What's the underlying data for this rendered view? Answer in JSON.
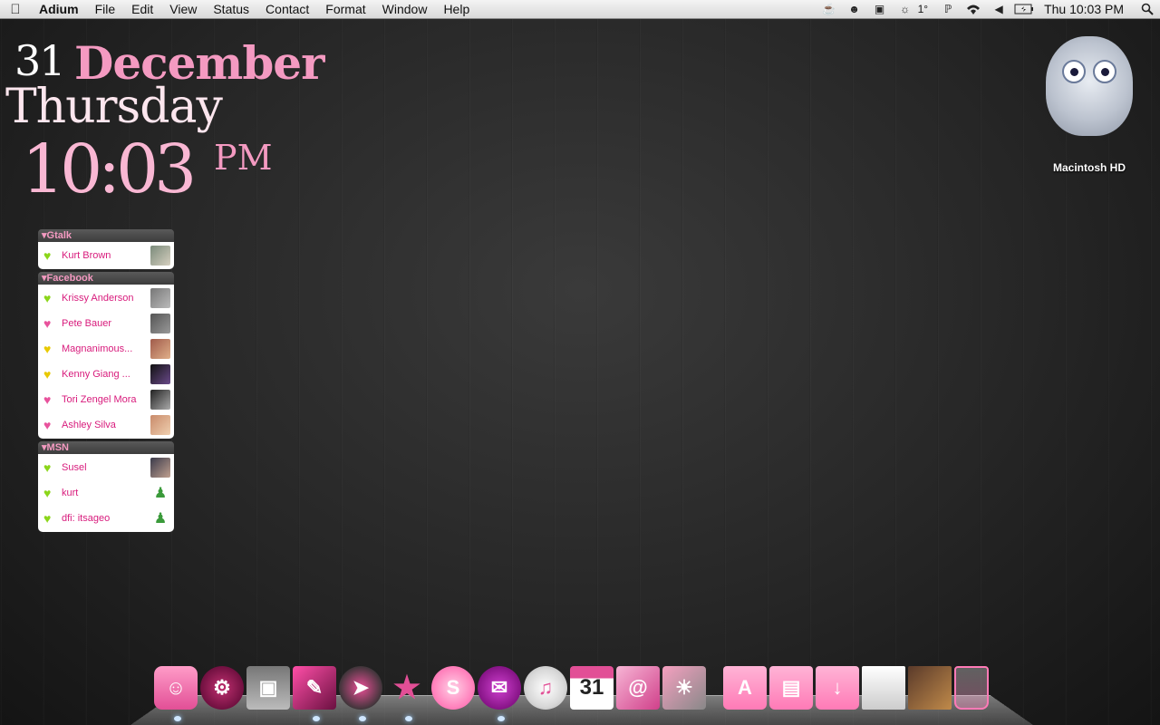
{
  "menubar": {
    "apple_icon": "apple-icon",
    "app_name": "Adium",
    "menus": [
      "File",
      "Edit",
      "View",
      "Status",
      "Contact",
      "Format",
      "Window",
      "Help"
    ],
    "status_icons": [
      "coffee-icon",
      "adium-duck-icon",
      "terminal-icon",
      "weather-icon",
      "bluetooth-icon",
      "wifi-icon",
      "volume-icon",
      "battery-icon"
    ],
    "temperature": "1°",
    "clock": "Thu 10:03 PM",
    "search_icon": "spotlight-icon"
  },
  "date_widget": {
    "day": "31",
    "month": "December",
    "weekday": "Thursday",
    "time": "10:03",
    "ampm": "PM"
  },
  "buddy_list": {
    "groups": [
      {
        "name": "Gtalk",
        "contacts": [
          {
            "name": "Kurt Brown",
            "status": "green"
          }
        ]
      },
      {
        "name": "Facebook",
        "contacts": [
          {
            "name": "Krissy Anderson",
            "status": "green"
          },
          {
            "name": "Pete Bauer",
            "status": "pink"
          },
          {
            "name": "Magnanimous...",
            "status": "yellow"
          },
          {
            "name": "Kenny Giang ...",
            "status": "yellow"
          },
          {
            "name": "Tori Zengel Mora",
            "status": "pink"
          },
          {
            "name": "Ashley Silva",
            "status": "pink"
          }
        ]
      },
      {
        "name": "MSN",
        "contacts": [
          {
            "name": "Susel",
            "status": "green"
          },
          {
            "name": "kurt",
            "status": "green"
          },
          {
            "name": "dfi: itsageo",
            "status": "green"
          }
        ]
      }
    ],
    "colors": {
      "green": "#8bd61a",
      "pink": "#e8529c",
      "yellow": "#e8c900",
      "name": "#d81b7c"
    }
  },
  "desktop": {
    "drive_label": "Macintosh HD"
  },
  "dock": {
    "apps": [
      "finder-icon",
      "dashboard-icon",
      "photo-booth-icon",
      "preview-icon",
      "safari-icon",
      "adium-icon",
      "skype-icon",
      "ichat-icon",
      "itunes-icon",
      "ical-icon",
      "address-book-icon",
      "iphoto-icon"
    ],
    "calendar_day": "31",
    "stacks": [
      "applications-folder-icon",
      "documents-folder-icon",
      "downloads-folder-icon",
      "window-icon",
      "photo-icon",
      "trash-icon"
    ]
  }
}
